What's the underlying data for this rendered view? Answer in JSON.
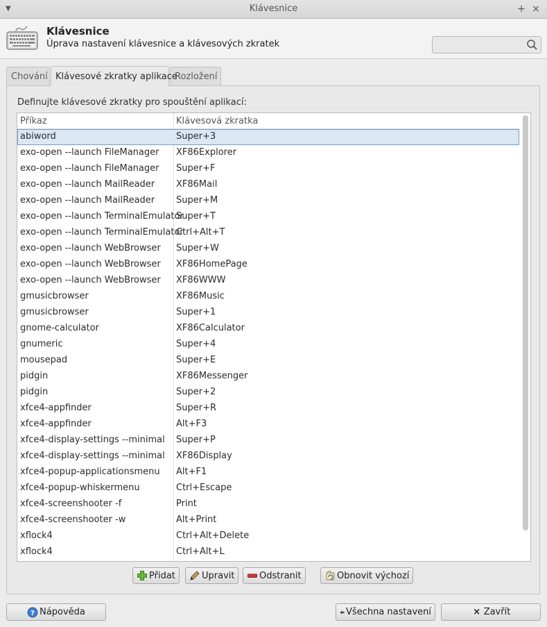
{
  "window": {
    "title": "Klávesnice"
  },
  "header": {
    "title": "Klávesnice",
    "subtitle": "Úprava nastavení klávesnice a klávesových zkratek",
    "search_placeholder": ""
  },
  "tabs": [
    {
      "label": "Chování",
      "active": false
    },
    {
      "label": "Klávesové zkratky aplikace",
      "active": true
    },
    {
      "label": "Rozložení",
      "active": false
    }
  ],
  "panel": {
    "description": "Definujte klávesové zkratky pro spouštění aplikací:"
  },
  "table": {
    "columns": [
      "Příkaz",
      "Klávesová zkratka"
    ],
    "rows": [
      {
        "command": "abiword",
        "shortcut": "Super+3",
        "selected": true
      },
      {
        "command": "exo-open --launch FileManager",
        "shortcut": "XF86Explorer"
      },
      {
        "command": "exo-open --launch FileManager",
        "shortcut": "Super+F"
      },
      {
        "command": "exo-open --launch MailReader",
        "shortcut": "XF86Mail"
      },
      {
        "command": "exo-open --launch MailReader",
        "shortcut": "Super+M"
      },
      {
        "command": "exo-open --launch TerminalEmulator",
        "shortcut": "Super+T"
      },
      {
        "command": "exo-open --launch TerminalEmulator",
        "shortcut": "Ctrl+Alt+T"
      },
      {
        "command": "exo-open --launch WebBrowser",
        "shortcut": "Super+W"
      },
      {
        "command": "exo-open --launch WebBrowser",
        "shortcut": "XF86HomePage"
      },
      {
        "command": "exo-open --launch WebBrowser",
        "shortcut": "XF86WWW"
      },
      {
        "command": "gmusicbrowser",
        "shortcut": "XF86Music"
      },
      {
        "command": "gmusicbrowser",
        "shortcut": "Super+1"
      },
      {
        "command": "gnome-calculator",
        "shortcut": "XF86Calculator"
      },
      {
        "command": "gnumeric",
        "shortcut": "Super+4"
      },
      {
        "command": "mousepad",
        "shortcut": "Super+E"
      },
      {
        "command": "pidgin",
        "shortcut": "XF86Messenger"
      },
      {
        "command": "pidgin",
        "shortcut": "Super+2"
      },
      {
        "command": "xfce4-appfinder",
        "shortcut": "Super+R"
      },
      {
        "command": "xfce4-appfinder",
        "shortcut": "Alt+F3"
      },
      {
        "command": "xfce4-display-settings --minimal",
        "shortcut": "Super+P"
      },
      {
        "command": "xfce4-display-settings --minimal",
        "shortcut": "XF86Display"
      },
      {
        "command": "xfce4-popup-applicationsmenu",
        "shortcut": "Alt+F1"
      },
      {
        "command": "xfce4-popup-whiskermenu",
        "shortcut": "Ctrl+Escape"
      },
      {
        "command": "xfce4-screenshooter -f",
        "shortcut": "Print"
      },
      {
        "command": "xfce4-screenshooter -w",
        "shortcut": "Alt+Print"
      },
      {
        "command": "xflock4",
        "shortcut": "Ctrl+Alt+Delete"
      },
      {
        "command": "xflock4",
        "shortcut": "Ctrl+Alt+L"
      }
    ]
  },
  "actions": {
    "add": "Přidat",
    "edit": "Upravit",
    "remove": "Odstranit",
    "reset": "Obnovit výchozí"
  },
  "footer": {
    "help": "Nápověda",
    "all_settings": "Všechna nastavení",
    "close": "Zavřít"
  },
  "icons": {
    "window_menu": "chevron-down-icon",
    "titlebar_maximize": "plus-icon",
    "titlebar_close": "close-icon",
    "header": "keyboard-icon",
    "search": "search-icon",
    "add": "plus-icon",
    "edit": "pencil-icon",
    "remove": "minus-icon",
    "reset": "restore-icon",
    "help": "help-icon",
    "all_settings": "arrow-left-icon",
    "close": "close-icon"
  },
  "colors": {
    "selection_bg": "#dce7f4",
    "selection_border": "#7a9bc6",
    "add_green": "#5aa02c",
    "remove_red": "#cc2a2a",
    "help_blue": "#3d7fd0"
  }
}
